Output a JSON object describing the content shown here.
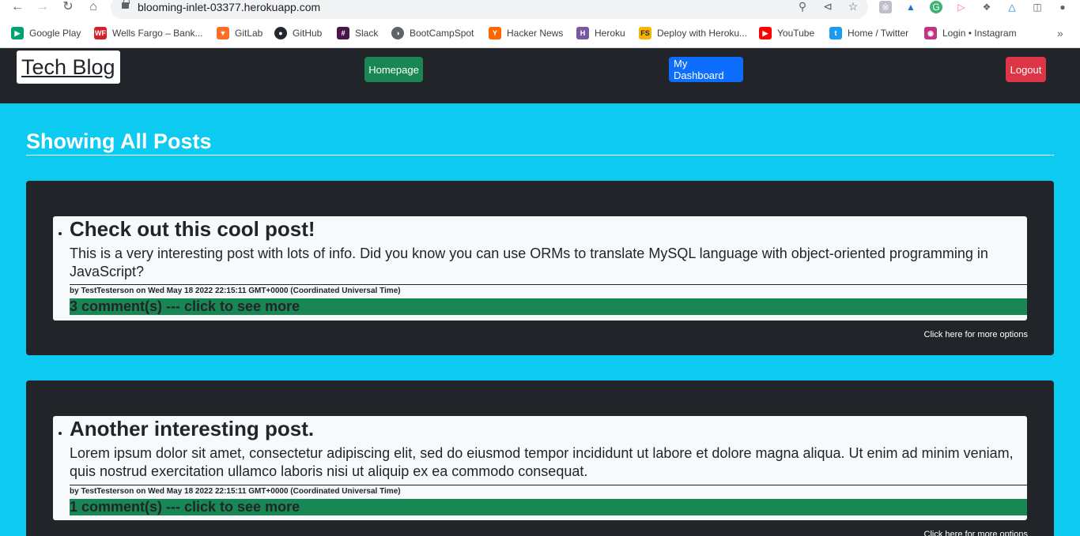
{
  "browser": {
    "url": "blooming-inlet-03377.herokuapp.com",
    "bookmarks": [
      {
        "label": "Google Play",
        "icon": "google-play-icon",
        "color": "#00a173"
      },
      {
        "label": "Wells Fargo – Bank...",
        "icon": "wells-fargo-icon",
        "color": "#d71e28"
      },
      {
        "label": "GitLab",
        "icon": "gitlab-icon",
        "color": "#fc6d26"
      },
      {
        "label": "GitHub",
        "icon": "github-icon",
        "color": "#24292f"
      },
      {
        "label": "Slack",
        "icon": "slack-icon",
        "color": "#4a154b"
      },
      {
        "label": "BootCampSpot",
        "icon": "bootcampspot-icon",
        "color": "#5f6368"
      },
      {
        "label": "Hacker News",
        "icon": "hacker-news-icon",
        "color": "#ff6600"
      },
      {
        "label": "Heroku",
        "icon": "heroku-icon",
        "color": "#79589f"
      },
      {
        "label": "Deploy with Heroku...",
        "icon": "deploy-heroku-icon",
        "color": "#f7b500"
      },
      {
        "label": "YouTube",
        "icon": "youtube-icon",
        "color": "#ff0000"
      },
      {
        "label": "Home / Twitter",
        "icon": "twitter-icon",
        "color": "#1d9bf0"
      },
      {
        "label": "Login • Instagram",
        "icon": "instagram-icon",
        "color": "#c13584"
      }
    ]
  },
  "header": {
    "brand": "Tech Blog",
    "homepage_label": "Homepage",
    "dashboard_label": "My Dashboard",
    "logout_label": "Logout",
    "colors": {
      "homepage": "#198754",
      "dashboard": "#0d6efd",
      "logout": "#dc3545"
    }
  },
  "main": {
    "title": "Showing All Posts",
    "posts": [
      {
        "title": "Check out this cool post!",
        "body": "This is a very interesting post with lots of info. Did you know you can use ORMs to translate MySQL language with object-oriented programming in JavaScript?",
        "meta": "by TestTesterson on Wed May 18 2022 22:15:11 GMT+0000 (Coordinated Universal Time)",
        "comments": "3 comment(s) --- click to see more",
        "more_options": "Click here for more options"
      },
      {
        "title": "Another interesting post.",
        "body": "Lorem ipsum dolor sit amet, consectetur adipiscing elit, sed do eiusmod tempor incididunt ut labore et dolore magna aliqua. Ut enim ad minim veniam, quis nostrud exercitation ullamco laboris nisi ut aliquip ex ea commodo consequat.",
        "meta": "by TestTesterson on Wed May 18 2022 22:15:11 GMT+0000 (Coordinated Universal Time)",
        "comments": "1 comment(s) --- click to see more",
        "more_options": "Click here for more options"
      }
    ]
  }
}
